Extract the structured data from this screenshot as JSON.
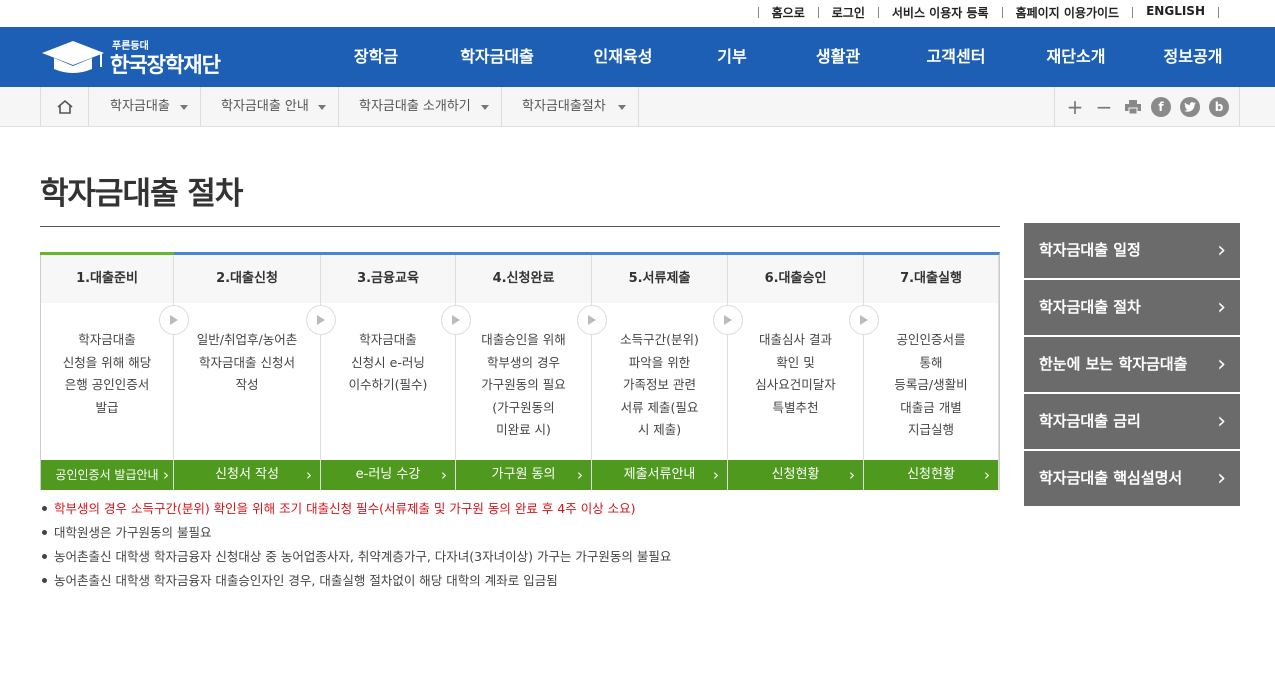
{
  "util_links": [
    "홈으로",
    "로그인",
    "서비스 이용자 등록",
    "홈페이지 이용가이드",
    "ENGLISH"
  ],
  "logo": {
    "sub": "푸른등대",
    "name": "한국장학재단"
  },
  "menu": [
    "장학금",
    "학자금대출",
    "인재육성",
    "기부",
    "생활관",
    "고객센터",
    "재단소개",
    "정보공개"
  ],
  "breadcrumb": [
    "학자금대출",
    "학자금대출 안내",
    "학자금대출 소개하기",
    "학자금대출절차"
  ],
  "tools": {
    "plus": "+",
    "minus": "−",
    "facebook": "f",
    "blog": "b"
  },
  "page_title": "학자금대출 절차",
  "steps": [
    {
      "head": "1.대출준비",
      "desc": "학자금대출\n신청을 위해 해당\n은행 공인인증서\n발급",
      "btn": "공인인증서 발급안내"
    },
    {
      "head": "2.대출신청",
      "desc": "일반/취업후/농어촌\n학자금대출 신청서\n작성",
      "btn": "신청서 작성"
    },
    {
      "head": "3.금융교육",
      "desc": "학자금대출\n신청시 e-러닝\n이수하기(필수)",
      "btn": "e-러닝 수강"
    },
    {
      "head": "4.신청완료",
      "desc": "대출승인을 위해\n학부생의 경우\n가구원동의 필요\n(가구원동의\n미완료 시)",
      "btn": "가구원 동의"
    },
    {
      "head": "5.서류제출",
      "desc": "소득구간(분위)\n파악을 위한\n가족정보 관련\n서류 제출(필요\n시 제출)",
      "btn": "제출서류안내"
    },
    {
      "head": "6.대출승인",
      "desc": "대출심사 결과\n확인 및\n심사요건미달자\n특별추천",
      "btn": "신청현황"
    },
    {
      "head": "7.대출실행",
      "desc": "공인인증서를\n통해\n등록금/생활비\n대출금 개별\n지급실행",
      "btn": "신청현황"
    }
  ],
  "notes": [
    {
      "text": "학부생의 경우 소득구간(분위) 확인을 위해 조기 대출신청 필수(서류제출 및 가구원 동의 완료 후 4주 이상 소요)",
      "red": true
    },
    {
      "text": "대학원생은 가구원동의 불필요",
      "red": false
    },
    {
      "text": "농어촌출신 대학생 학자금융자 신청대상 중 농어업종사자, 취약계층가구, 다자녀(3자녀이상) 가구는 가구원동의 불필요",
      "red": false
    },
    {
      "text": "농어촌출신 대학생 학자금융자 대출승인자인 경우, 대출실행 절차없이 해당 대학의 계좌로 입금됨",
      "red": false
    }
  ],
  "side_menu": [
    "학자금대출 일정",
    "학자금대출 절차",
    "한눈에 보는 학자금대출",
    "학자금대출 금리",
    "학자금대출 핵심설명서"
  ],
  "colors": {
    "brand_blue": "#1d5fb5",
    "step_green": "#4f9a1e",
    "side_gray": "#6b6b6b",
    "note_red": "#d5151b"
  }
}
